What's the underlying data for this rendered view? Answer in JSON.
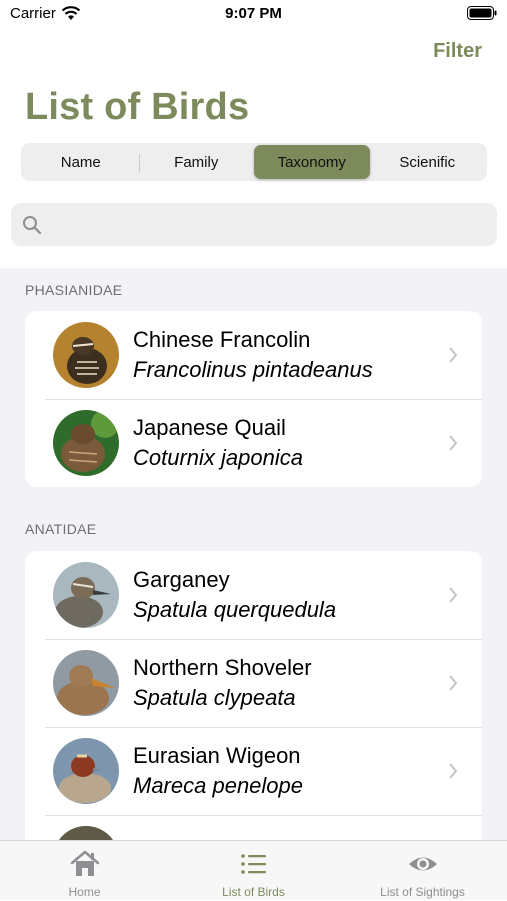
{
  "status_bar": {
    "carrier": "Carrier",
    "time": "9:07 PM"
  },
  "nav": {
    "filter_label": "Filter",
    "title": "List of Birds"
  },
  "segments": [
    {
      "label": "Name",
      "selected": false
    },
    {
      "label": "Family",
      "selected": false
    },
    {
      "label": "Taxonomy",
      "selected": true
    },
    {
      "label": "Scienific",
      "selected": false
    }
  ],
  "search": {
    "placeholder": "",
    "value": ""
  },
  "sections": [
    {
      "header": "PHASIANIDAE",
      "birds": [
        {
          "common": "Chinese Francolin",
          "scientific": "Francolinus pintadeanus"
        },
        {
          "common": "Japanese Quail",
          "scientific": "Coturnix japonica"
        }
      ]
    },
    {
      "header": "ANATIDAE",
      "birds": [
        {
          "common": "Garganey",
          "scientific": "Spatula querquedula"
        },
        {
          "common": "Northern Shoveler",
          "scientific": "Spatula clypeata"
        },
        {
          "common": "Eurasian Wigeon",
          "scientific": "Mareca penelope"
        }
      ]
    }
  ],
  "tabbar": [
    {
      "label": "Home",
      "icon": "house-icon",
      "active": false
    },
    {
      "label": "List of Birds",
      "icon": "list-icon",
      "active": true
    },
    {
      "label": "List of Sightings",
      "icon": "eye-icon",
      "active": false
    }
  ],
  "colors": {
    "accent": "#7c8a5c",
    "grouped_background": "#f2f2f7"
  }
}
